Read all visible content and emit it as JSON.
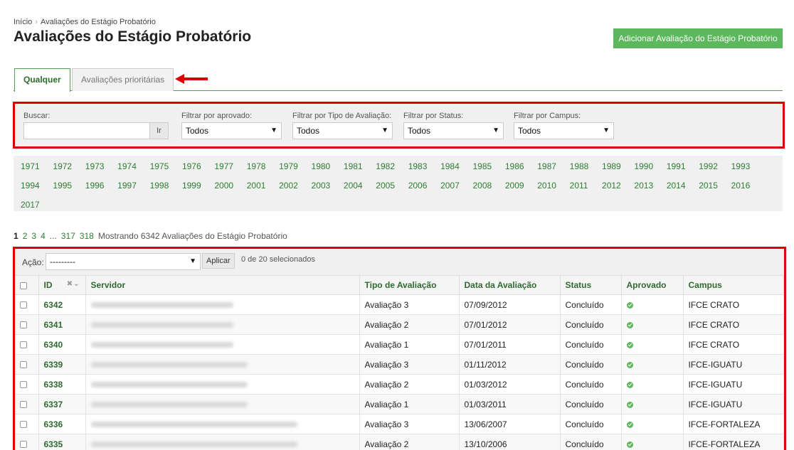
{
  "breadcrumb": {
    "home": "Início",
    "current": "Avaliações do Estágio Probatório"
  },
  "page": {
    "title": "Avaliações do Estágio Probatório",
    "add_label": "Adicionar Avaliação do Estágio Probatório"
  },
  "tabs": [
    {
      "label": "Qualquer"
    },
    {
      "label": "Avaliações prioritárias"
    }
  ],
  "filters": {
    "search_label": "Buscar:",
    "search_value": "",
    "search_button": "Ir",
    "approved": {
      "label": "Filtrar por aprovado:",
      "value": "Todos"
    },
    "type": {
      "label": "Filtrar por Tipo de Avaliação:",
      "value": "Todos"
    },
    "status": {
      "label": "Filtrar por Status:",
      "value": "Todos"
    },
    "campus": {
      "label": "Filtrar por Campus:",
      "value": "Todos"
    }
  },
  "years": [
    "1971",
    "1972",
    "1973",
    "1974",
    "1975",
    "1976",
    "1977",
    "1978",
    "1979",
    "1980",
    "1981",
    "1982",
    "1983",
    "1984",
    "1985",
    "1986",
    "1987",
    "1988",
    "1989",
    "1990",
    "1991",
    "1992",
    "1993",
    "1994",
    "1995",
    "1996",
    "1997",
    "1998",
    "1999",
    "2000",
    "2001",
    "2002",
    "2003",
    "2004",
    "2005",
    "2006",
    "2007",
    "2008",
    "2009",
    "2010",
    "2011",
    "2012",
    "2013",
    "2014",
    "2015",
    "2016",
    "2017"
  ],
  "pagination": {
    "pages": [
      "1",
      "2",
      "3",
      "4",
      "...",
      "317",
      "318"
    ],
    "summary": "Mostrando 6342 Avaliações do Estágio Probatório"
  },
  "actions": {
    "label": "Ação:",
    "value": "---------",
    "apply": "Aplicar",
    "selected": "0 de 20 selecionados"
  },
  "table": {
    "headers": {
      "id": "ID",
      "servidor": "Servidor",
      "tipo": "Tipo de Avaliação",
      "data": "Data da Avaliação",
      "status": "Status",
      "aprovado": "Aprovado",
      "campus": "Campus"
    },
    "rows": [
      {
        "id": "6342",
        "tipo": "Avaliação 3",
        "data": "07/09/2012",
        "status": "Concluído",
        "campus": "IFCE CRATO"
      },
      {
        "id": "6341",
        "tipo": "Avaliação 2",
        "data": "07/01/2012",
        "status": "Concluído",
        "campus": "IFCE CRATO"
      },
      {
        "id": "6340",
        "tipo": "Avaliação 1",
        "data": "07/01/2011",
        "status": "Concluído",
        "campus": "IFCE CRATO"
      },
      {
        "id": "6339",
        "tipo": "Avaliação 3",
        "data": "01/11/2012",
        "status": "Concluído",
        "campus": "IFCE-IGUATU"
      },
      {
        "id": "6338",
        "tipo": "Avaliação 2",
        "data": "01/03/2012",
        "status": "Concluído",
        "campus": "IFCE-IGUATU"
      },
      {
        "id": "6337",
        "tipo": "Avaliação 1",
        "data": "01/03/2011",
        "status": "Concluído",
        "campus": "IFCE-IGUATU"
      },
      {
        "id": "6336",
        "tipo": "Avaliação 3",
        "data": "13/06/2007",
        "status": "Concluído",
        "campus": "IFCE-FORTALEZA"
      },
      {
        "id": "6335",
        "tipo": "Avaliação 2",
        "data": "13/10/2006",
        "status": "Concluído",
        "campus": "IFCE-FORTALEZA"
      }
    ]
  },
  "colors": {
    "accent": "#5cb85c",
    "link": "#2e7d32",
    "highlight": "#dd0000"
  }
}
